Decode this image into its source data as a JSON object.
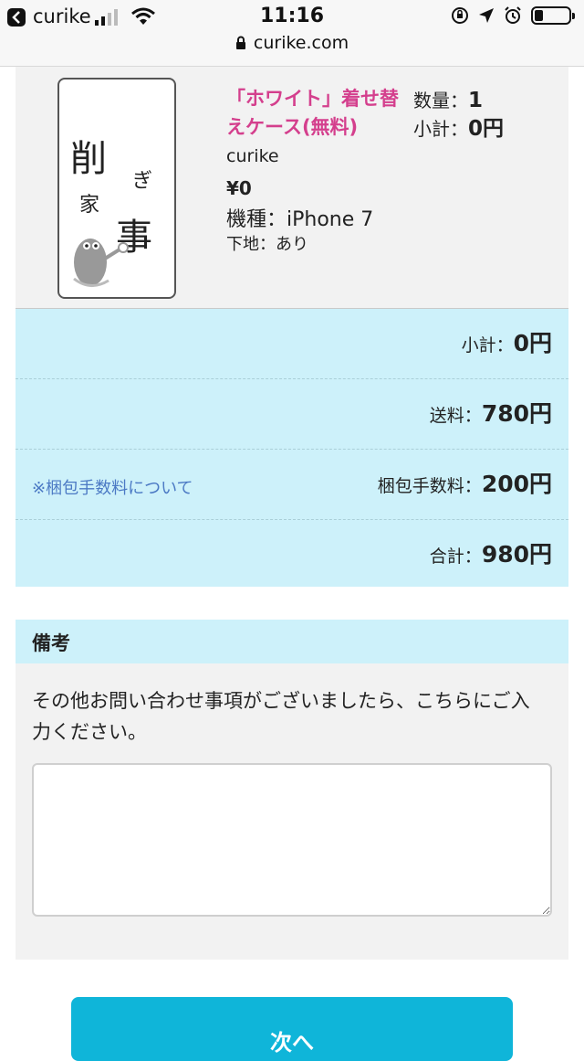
{
  "status_bar": {
    "back_app": "curike",
    "time": "11:16",
    "battery_level": 0.25
  },
  "browser": {
    "url": "curike.com"
  },
  "product": {
    "name": "「ホワイト」着せ替えケース(無料)",
    "qty_label": "数量：",
    "qty_value": "1",
    "subtotal_label": "小計：",
    "subtotal_value": "0円",
    "brand": "curike",
    "price": "¥0",
    "model": "機種：iPhone 7",
    "base": "下地：あり",
    "image_text": [
      "削",
      "ぎ",
      "家",
      "事"
    ]
  },
  "totals": {
    "subtotal_label": "小計：",
    "subtotal_value": "0円",
    "shipping_label": "送料：",
    "shipping_value": "780円",
    "packing_link": "※梱包手数料について",
    "packing_label": "梱包手数料：",
    "packing_value": "200円",
    "total_label": "合計：",
    "total_value": "980円"
  },
  "notes": {
    "title": "備考",
    "description": "その他お問い合わせ事項がございましたら、こちらにご入力ください。",
    "value": ""
  },
  "next_button": {
    "label": "次へ"
  },
  "colors": {
    "accent_pink": "#d43f8d",
    "panel_blue": "#cdf1fa",
    "button_cyan": "#0fb5d9",
    "link_blue": "#4b79c4"
  }
}
